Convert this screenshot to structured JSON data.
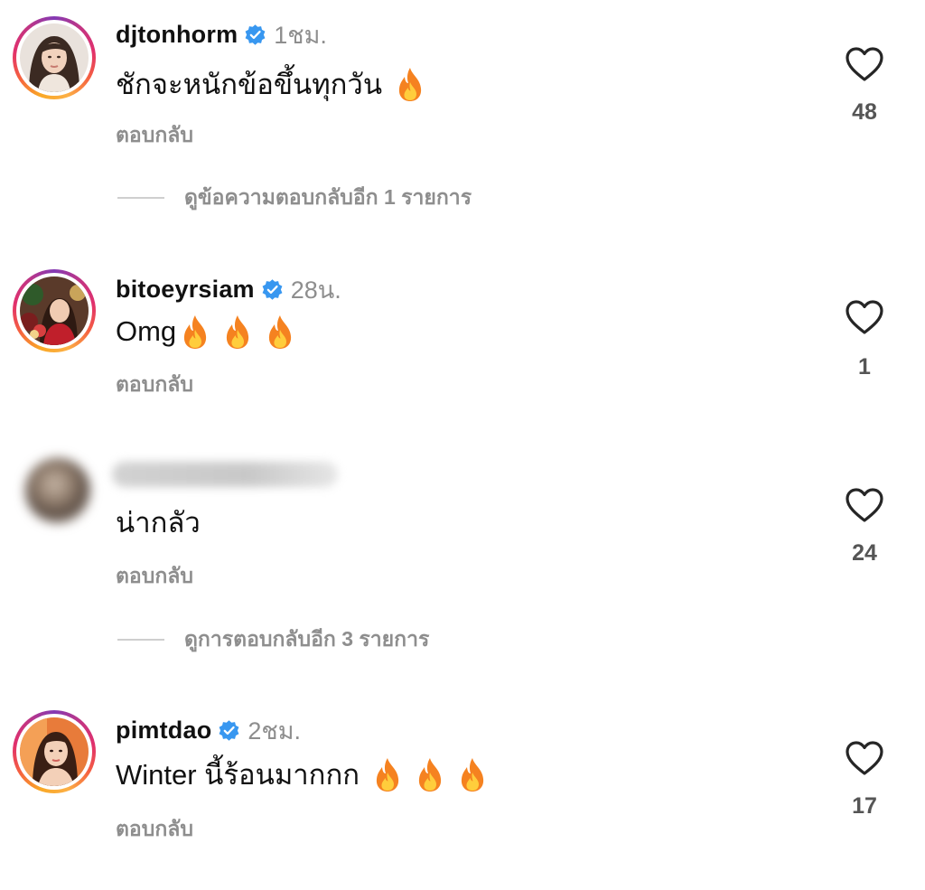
{
  "accent_colors": {
    "verified_blue": "#3897f0",
    "secondary_text": "#8e8e8e",
    "fire_orange": "#f58220",
    "fire_yellow": "#ffcd3c"
  },
  "comments": [
    {
      "username": "djtonhorm",
      "verified": true,
      "time": "1ชม.",
      "text": "ชักจะหนักข้อขึ้นทุกวัน",
      "emoji_count": 1,
      "emoji": "fire-icon",
      "reply_label": "ตอบกลับ",
      "likes": "48",
      "view_replies_label": "ดูข้อความตอบกลับอีก 1 รายการ",
      "has_story_ring": true
    },
    {
      "username": "bitoeyrsiam",
      "verified": true,
      "time": "28น.",
      "text": "Omg",
      "emoji_count": 3,
      "emoji": "fire-icon",
      "reply_label": "ตอบกลับ",
      "likes": "1",
      "has_story_ring": true
    },
    {
      "username_blurred": true,
      "text": "น่ากลัว",
      "reply_label": "ตอบกลับ",
      "likes": "24",
      "view_replies_label": "ดูการตอบกลับอีก 3 รายการ",
      "has_story_ring": false
    },
    {
      "username": "pimtdao",
      "verified": true,
      "time": "2ชม.",
      "text": "Winter นี้ร้อนมากกก",
      "emoji_count": 3,
      "emoji": "fire-icon",
      "reply_label": "ตอบกลับ",
      "likes": "17",
      "has_story_ring": true
    }
  ]
}
